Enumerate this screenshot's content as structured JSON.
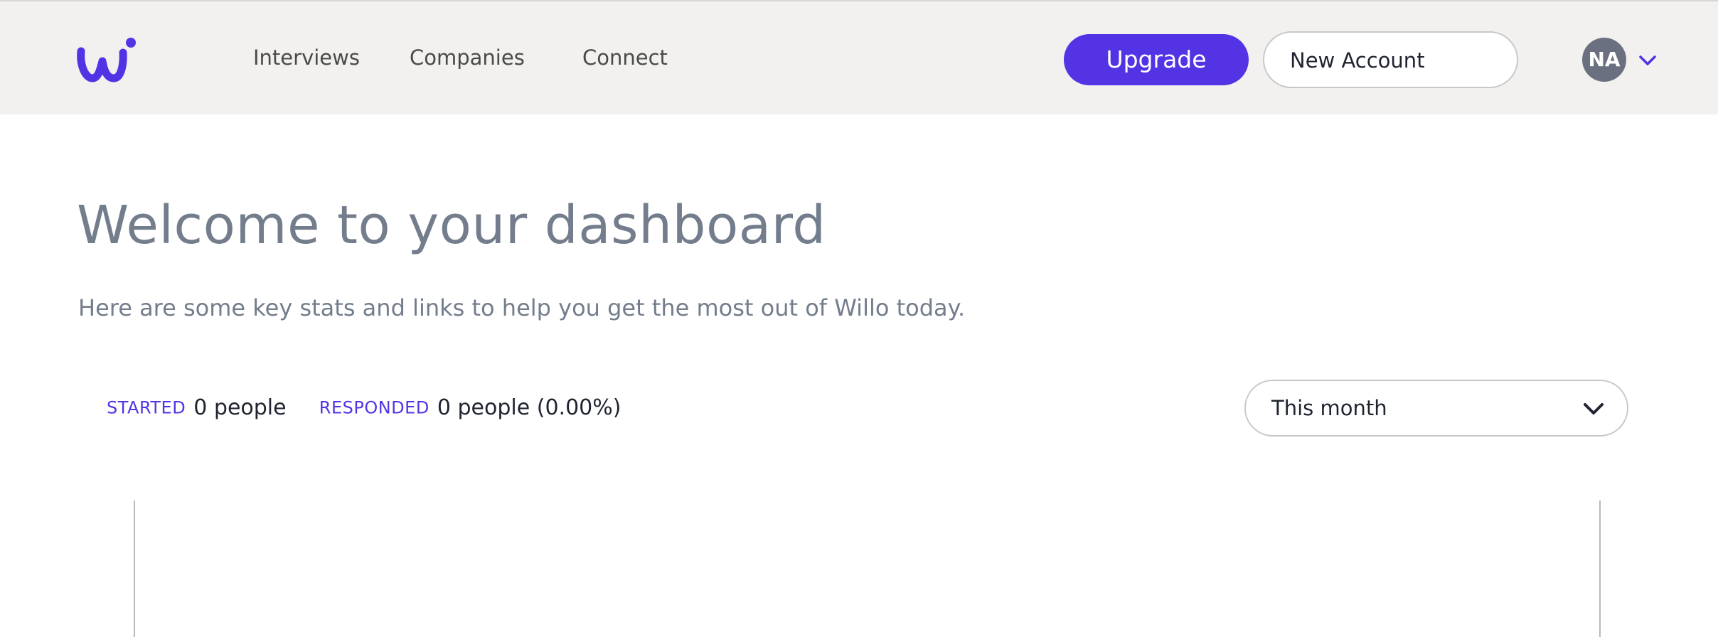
{
  "header": {
    "logo_icon": "willo-logo",
    "nav": [
      {
        "label": "Interviews"
      },
      {
        "label": "Companies"
      },
      {
        "label": "Connect"
      }
    ],
    "upgrade_label": "Upgrade",
    "account_select_value": "New Account",
    "avatar_initials": "NA",
    "avatar_menu_icon": "chevron-down-icon"
  },
  "main": {
    "title": "Welcome to your dashboard",
    "subtitle": "Here are some key stats and links to help you get the most out of Willo today.",
    "stats": {
      "started_label": "STARTED",
      "started_value": "0 people",
      "responded_label": "RESPONDED",
      "responded_value": "0 people (0.00%)"
    },
    "period_select_value": "This month",
    "period_select_icon": "chevron-down-icon"
  },
  "colors": {
    "brand": "#5433e5",
    "header_bg": "#f2f1ef",
    "title_text": "#737d8c",
    "avatar_bg": "#6b7080"
  }
}
